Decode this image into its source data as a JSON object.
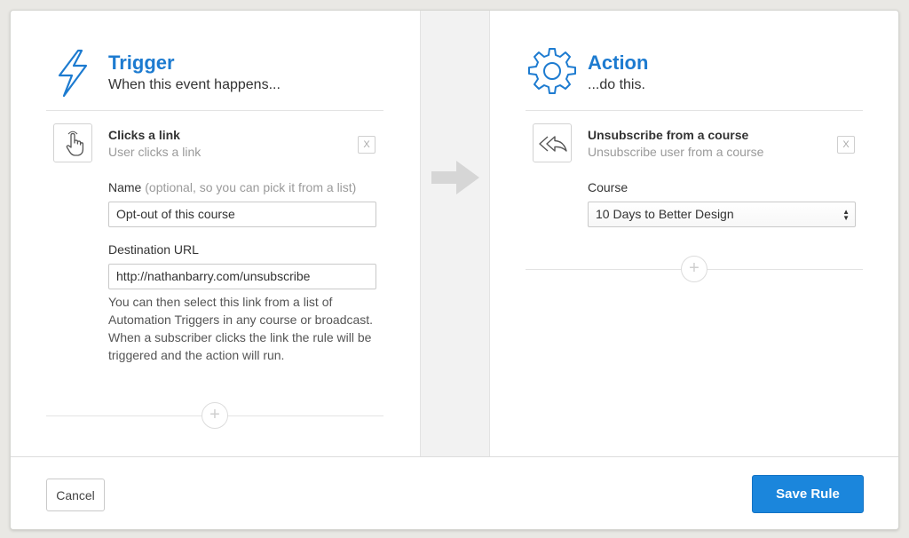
{
  "trigger": {
    "title": "Trigger",
    "subtitle": "When this event happens...",
    "item_title": "Clicks a link",
    "item_subtitle": "User clicks a link",
    "remove_label": "X",
    "name_label": "Name",
    "name_hint": "(optional, so you can pick it from a list)",
    "name_value": "Opt-out of this course",
    "url_label": "Destination URL",
    "url_value": "http://nathanbarry.com/unsubscribe",
    "help_text": "You can then select this link from a list of Automation Triggers in any course or broadcast. When a subscriber clicks the link the rule will be triggered and the action will run.",
    "add_label": "+"
  },
  "action": {
    "title": "Action",
    "subtitle": "...do this.",
    "item_title": "Unsubscribe from a course",
    "item_subtitle": "Unsubscribe user from a course",
    "remove_label": "X",
    "course_label": "Course",
    "course_value": "10 Days to Better Design",
    "add_label": "+"
  },
  "footer": {
    "cancel_label": "Cancel",
    "save_label": "Save Rule"
  },
  "icons": {
    "trigger": "lightning-icon",
    "action": "gear-icon",
    "trigger_item": "hand-pointer-icon",
    "action_item": "reply-all-icon",
    "flow": "arrow-right-icon"
  },
  "colors": {
    "accent": "#1d7bd0",
    "save_button": "#1b86dc",
    "background": "#e9e8e4"
  }
}
